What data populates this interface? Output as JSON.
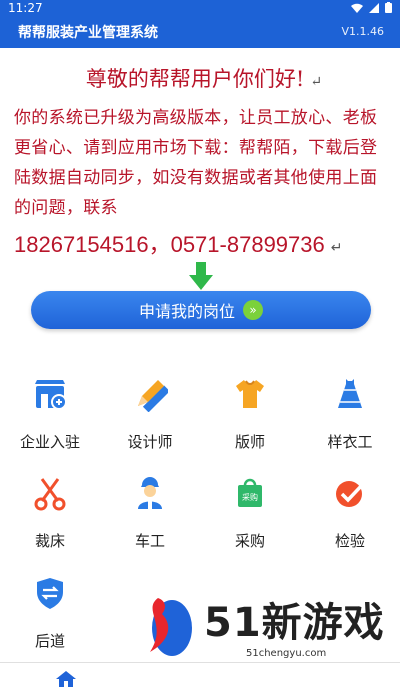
{
  "status": {
    "time": "11:27"
  },
  "app": {
    "title": "帮帮服装产业管理系统",
    "version": "V1.1.46"
  },
  "notice": {
    "greeting": "尊敬的帮帮用户你们好!",
    "body": "你的系统已升级为高级版本，让员工放心、老板更省心、请到应用市场下载：帮帮陌，下载后登陆数据自动同步，如没有数据或者其他使用上面的问题，联系",
    "contact": "18267154516，0571-87899736"
  },
  "apply_button": {
    "label": "申请我的岗位"
  },
  "grid": [
    {
      "label": "企业入驻",
      "icon": "shop-add-icon",
      "color": "#2b7be4"
    },
    {
      "label": "设计师",
      "icon": "pencil-ruler-icon",
      "color": "#2b7be4"
    },
    {
      "label": "版师",
      "icon": "shirt-icon",
      "color": "#f6a523"
    },
    {
      "label": "样衣工",
      "icon": "dress-icon",
      "color": "#2b7be4"
    },
    {
      "label": "裁床",
      "icon": "scissors-icon",
      "color": "#f1502c"
    },
    {
      "label": "车工",
      "icon": "worker-icon",
      "color": "#2b7be4"
    },
    {
      "label": "采购",
      "icon": "shopping-bag-icon",
      "color": "#2fb86a"
    },
    {
      "label": "检验",
      "icon": "check-badge-icon",
      "color": "#f1502c"
    },
    {
      "label": "后道",
      "icon": "shield-transfer-icon",
      "color": "#2b7be4"
    }
  ],
  "watermark": {
    "brand": "51新游戏",
    "url": "51chengyu.com"
  }
}
